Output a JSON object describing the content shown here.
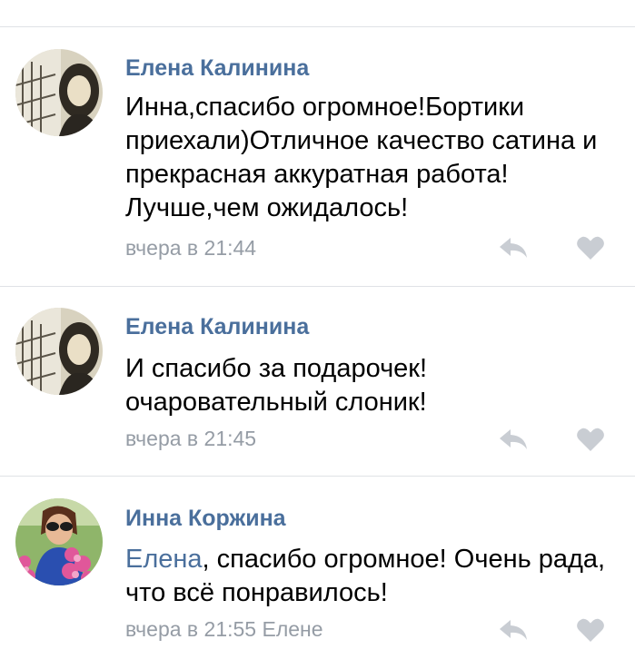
{
  "comments": [
    {
      "author": "Елена Калинина",
      "text": "Инна,спасибо огромное!Бортики приехали)Отличное качество сатина и прекрасная аккуратная работа!Лучше,чем ожидалось!",
      "time": "вчера в 21:44"
    },
    {
      "author": "Елена Калинина",
      "text": "И спасибо за подарочек! очаровательный слоник!",
      "time": "вчера в 21:45"
    },
    {
      "author": "Инна Коржина",
      "mention": "Елена",
      "text": ", спасибо огромное! Очень рада, что всё понравилось!",
      "time": "вчера в 21:55 Елене"
    }
  ],
  "icons": {
    "reply": "reply-icon",
    "like": "heart-icon"
  },
  "colors": {
    "author": "#4a6f9c",
    "meta": "#959ca5",
    "icon": "#c9cdd3",
    "divider": "#dfe2e6"
  }
}
